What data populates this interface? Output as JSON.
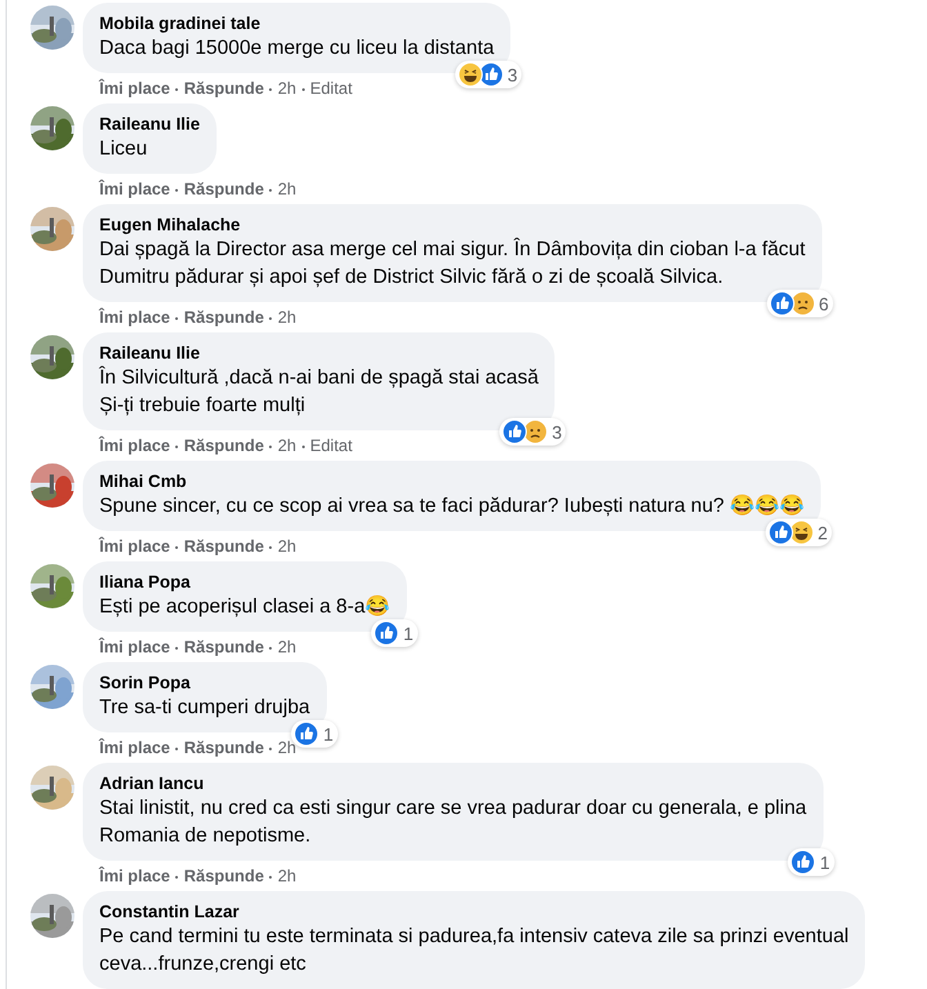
{
  "comments": [
    {
      "avatar": {
        "kind": "picture",
        "color": "#8aa0b8"
      },
      "name": "Mobila gradinei tale",
      "lines": [
        "Daca bagi 15000e merge cu liceu la distanta"
      ],
      "reactions": {
        "items": [
          {
            "kind": "haha"
          },
          {
            "kind": "like"
          }
        ],
        "count": "3"
      },
      "actions": [
        "Îmi place",
        "Răspunde",
        "2h",
        "Editat"
      ]
    },
    {
      "avatar": {
        "kind": "picture",
        "color": "#4f6b2e"
      },
      "name": "Raileanu Ilie",
      "lines": [
        "Liceu"
      ],
      "actions": [
        "Îmi place",
        "Răspunde",
        "2h"
      ]
    },
    {
      "avatar": {
        "kind": "picture",
        "color": "#c79a6a"
      },
      "name": "Eugen Mihalache",
      "lines": [
        "Dai șpagă la Director asa merge cel mai sigur. În Dâmbovița din cioban l-a făcut",
        "Dumitru pădurar și apoi șef de District Silvic fără o zi de școală Silvica."
      ],
      "reactions": {
        "items": [
          {
            "kind": "like"
          },
          {
            "kind": "sad"
          }
        ],
        "count": "6"
      },
      "actions": [
        "Îmi place",
        "Răspunde",
        "2h"
      ]
    },
    {
      "avatar": {
        "kind": "picture",
        "color": "#4f6b2e"
      },
      "name": "Raileanu Ilie",
      "lines": [
        "În Silvicultură ,dacă n-ai bani de șpagă stai acasă",
        "Și-ți trebuie foarte mulți"
      ],
      "reactions": {
        "items": [
          {
            "kind": "like"
          },
          {
            "kind": "sad"
          }
        ],
        "count": "3"
      },
      "actions": [
        "Îmi place",
        "Răspunde",
        "2h",
        "Editat"
      ]
    },
    {
      "avatar": {
        "kind": "picture",
        "color": "#c8402e"
      },
      "name": "Mihai Cmb",
      "lines": [
        "Spune sincer, cu ce scop ai vrea sa te faci pădurar? Iubești natura nu? 😂😂😂"
      ],
      "reactions": {
        "items": [
          {
            "kind": "like"
          },
          {
            "kind": "haha"
          }
        ],
        "count": "2"
      },
      "actions": [
        "Îmi place",
        "Răspunde",
        "2h"
      ]
    },
    {
      "avatar": {
        "kind": "picture",
        "color": "#6b8a3a"
      },
      "name": "Iliana Popa",
      "lines": [
        "Ești pe acoperișul clasei a 8-a😂"
      ],
      "reactions": {
        "items": [
          {
            "kind": "like"
          }
        ],
        "count": "1"
      },
      "actions": [
        "Îmi place",
        "Răspunde",
        "2h"
      ]
    },
    {
      "avatar": {
        "kind": "picture",
        "color": "#7fa3d0"
      },
      "name": "Sorin Popa",
      "lines": [
        "Tre sa-ti cumperi drujba"
      ],
      "reactions": {
        "items": [
          {
            "kind": "like"
          }
        ],
        "count": "1"
      },
      "actions": [
        "Îmi place",
        "Răspunde",
        "2h"
      ]
    },
    {
      "avatar": {
        "kind": "picture",
        "color": "#d8b98a"
      },
      "name": "Adrian Iancu",
      "lines": [
        "Stai linistit, nu cred ca esti singur care se vrea padurar doar cu generala, e plina",
        "Romania de nepotisme."
      ],
      "reactions": {
        "items": [
          {
            "kind": "like"
          }
        ],
        "count": "1"
      },
      "actions": [
        "Îmi place",
        "Răspunde",
        "2h"
      ]
    },
    {
      "avatar": {
        "kind": "picture",
        "color": "#9a9a9a"
      },
      "name": "Constantin Lazar",
      "lines": [
        "Pe cand termini tu este terminata si padurea,fa intensiv cateva zile sa prinzi eventual",
        "ceva...frunze,crengi etc"
      ]
    }
  ]
}
